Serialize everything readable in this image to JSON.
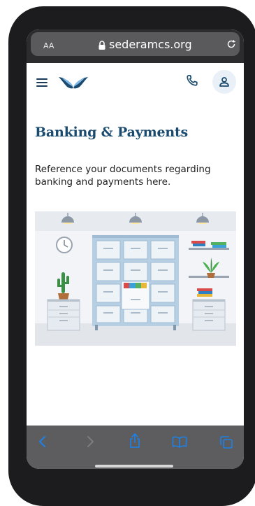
{
  "browser": {
    "text_size_label": "AA",
    "url": "sederamcs.org"
  },
  "site_header": {
    "logo": "wings-logo",
    "icons": [
      "hamburger-menu-icon",
      "phone-icon",
      "user-icon"
    ]
  },
  "page": {
    "title": "Banking & Payments",
    "description": "Reference your documents regarding banking and payments here."
  },
  "toolbar": {
    "icons": [
      "back-icon",
      "forward-icon",
      "share-icon",
      "bookmarks-icon",
      "tabs-icon"
    ]
  },
  "colors": {
    "brand_navy": "#1a4a6e",
    "accent_blue": "#1a82e8",
    "safari_chrome": "#2c2c2e"
  }
}
